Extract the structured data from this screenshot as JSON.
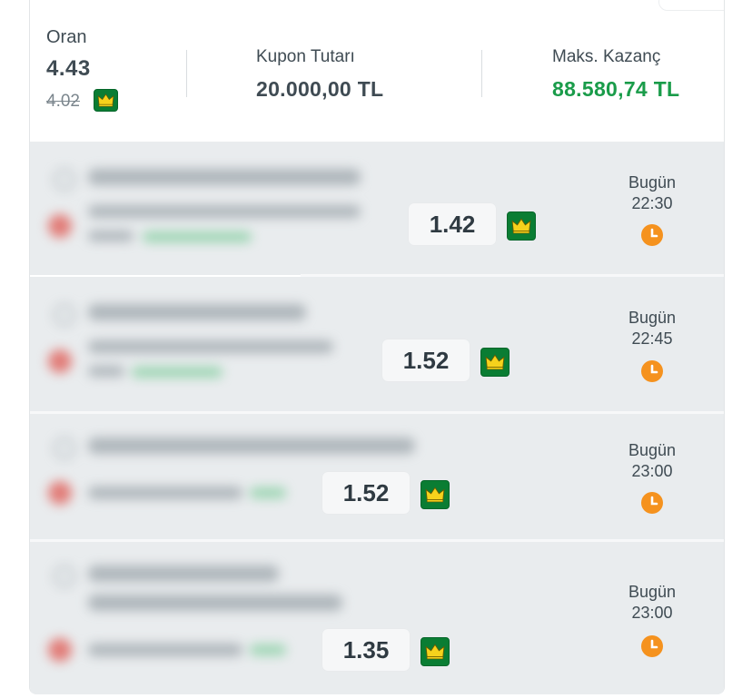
{
  "summary": {
    "oran_label": "Oran",
    "oran_value": "4.43",
    "oran_old": "4.02",
    "kupon_label": "Kupon Tutarı",
    "kupon_value": "20.000,00 TL",
    "maks_label": "Maks. Kazanç",
    "maks_value": "88.580,74 TL"
  },
  "matches": [
    {
      "odd": "1.42",
      "day": "Bugün",
      "time": "22:30"
    },
    {
      "odd": "1.52",
      "day": "Bugün",
      "time": "22:45"
    },
    {
      "odd": "1.52",
      "day": "Bugün",
      "time": "23:00"
    },
    {
      "odd": "1.35",
      "day": "Bugün",
      "time": "23:00"
    }
  ],
  "colors": {
    "brand_green": "#0a7d33",
    "win_green": "#1a9c4a",
    "clock_orange": "#f5921e",
    "row_bg": "#e9ecee"
  },
  "icons": [
    "crown-icon",
    "clock-icon"
  ]
}
